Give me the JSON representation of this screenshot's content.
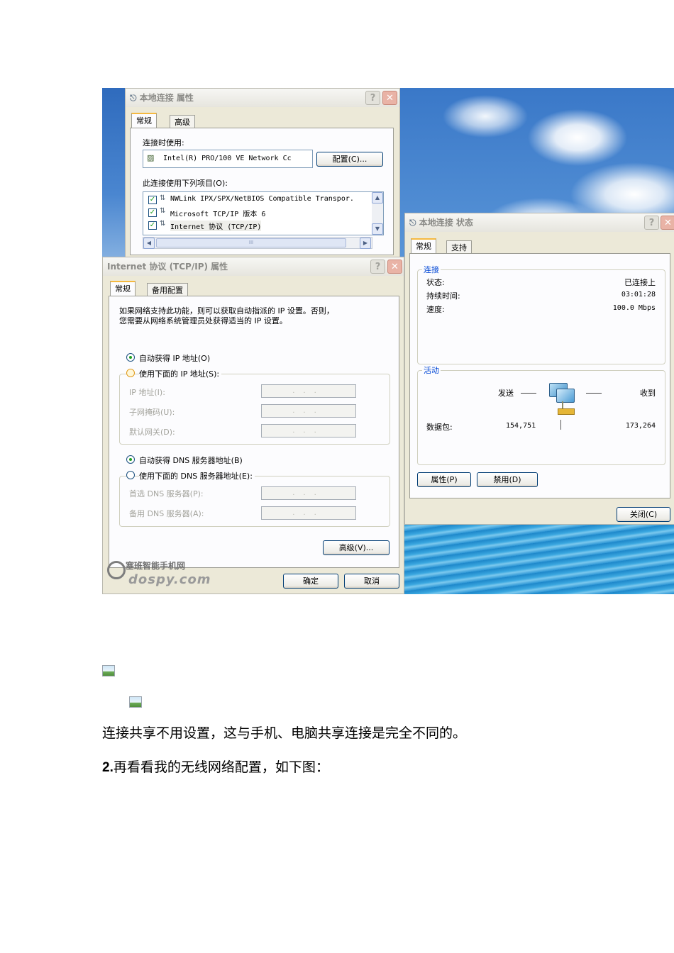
{
  "local_props": {
    "title": "本地连接 属性",
    "help": "?",
    "close": "✕",
    "tabs": [
      "常规",
      "高级"
    ],
    "connect_using": "连接时使用:",
    "adapter": "Intel(R) PRO/100 VE Network Cc",
    "config_button": "配置(C)...",
    "items_label": "此连接使用下列项目(O):",
    "items": [
      "NWLink IPX/SPX/NetBIOS Compatible Transpor.",
      "Microsoft TCP/IP 版本 6",
      "Internet 协议 (TCP/IP)"
    ],
    "hscroll_mark": "III"
  },
  "tcpip": {
    "title": "Internet 协议 (TCP/IP) 属性",
    "help": "?",
    "close": "✕",
    "tabs": [
      "常规",
      "备用配置"
    ],
    "desc_line1": "如果网络支持此功能，则可以获取自动指派的 IP 设置。否则，",
    "desc_line2": "您需要从网络系统管理员处获得适当的 IP 设置。",
    "auto_ip": "自动获得 IP 地址(O)",
    "manual_ip": "使用下面的 IP 地址(S):",
    "ip_label": "IP 地址(I):",
    "mask_label": "子网掩码(U):",
    "gateway_label": "默认网关(D):",
    "field_dots": "...",
    "auto_dns": "自动获得 DNS 服务器地址(B)",
    "manual_dns": "使用下面的 DNS 服务器地址(E):",
    "pref_dns": "首选 DNS 服务器(P):",
    "alt_dns": "备用 DNS 服务器(A):",
    "advanced_button": "高级(V)...",
    "ok_button": "确定",
    "cancel_button": "取消"
  },
  "status": {
    "title": "本地连接 状态",
    "help": "?",
    "close": "✕",
    "tabs": [
      "常规",
      "支持"
    ],
    "connection_group": "连接",
    "state_label": "状态:",
    "state_value": "已连接上",
    "duration_label": "持续时间:",
    "duration_value": "03:01:28",
    "speed_label": "速度:",
    "speed_value": "100.0 Mbps",
    "activity_group": "活动",
    "sent_label": "发送",
    "received_label": "收到",
    "packets_label": "数据包:",
    "packets_sent": "154,751",
    "packets_received": "173,264",
    "properties_button": "属性(P)",
    "disable_button": "禁用(D)",
    "close_button": "关闭(C)"
  },
  "watermark": {
    "line1": "塞班智能手机网",
    "line2": "dospy.com"
  },
  "document": {
    "para1": "连接共享不用设置，这与手机、电脑共享连接是完全不同的。",
    "para2_num": "2.",
    "para2_text": "再看看我的无线网络配置，如下图："
  }
}
